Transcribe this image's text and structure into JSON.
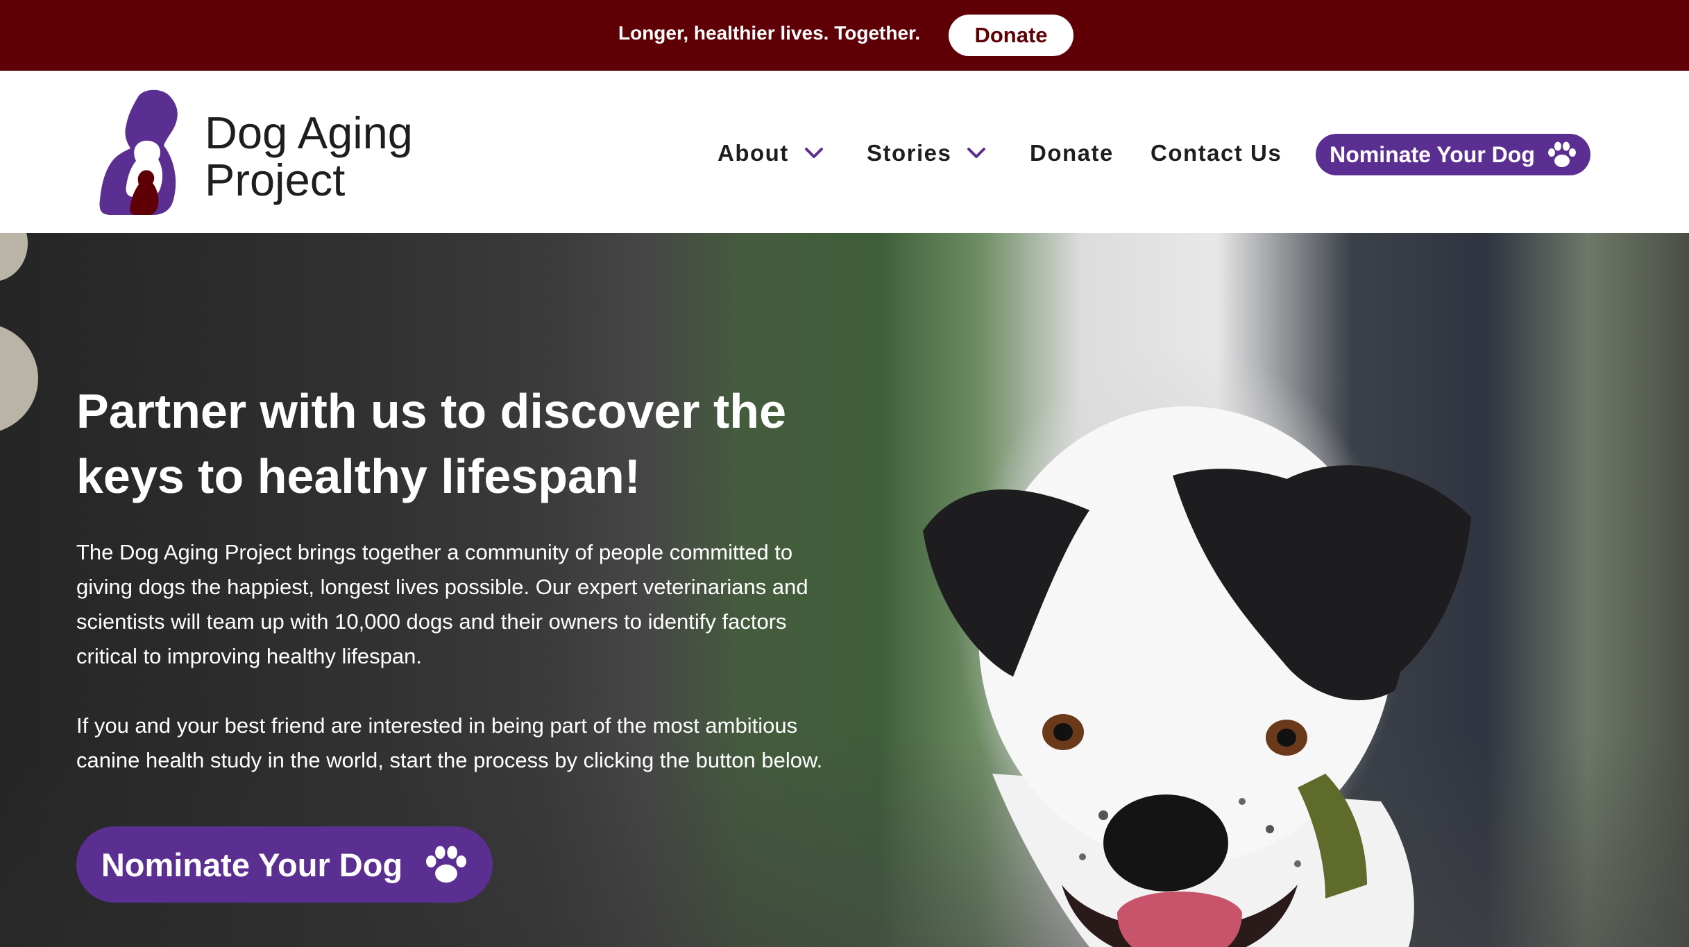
{
  "top_banner": {
    "tagline": "Longer, healthier lives. Together.",
    "donate_label": "Donate"
  },
  "header": {
    "logo_line1": "Dog Aging",
    "logo_line2": "Project",
    "nav": {
      "about": "About",
      "stories": "Stories",
      "donate": "Donate",
      "contact": "Contact Us"
    },
    "nominate_label": "Nominate Your Dog"
  },
  "hero": {
    "title": "Partner with us to discover the keys to healthy lifespan!",
    "paragraph1": "The Dog Aging Project brings together a community of people committed to giving dogs the happiest, longest lives possible. Our expert veterinarians and scientists will team up with 10,000 dogs and their owners to identify factors critical to improving healthy lifespan.",
    "paragraph2": "If you and your best friend are interested in being part of the most ambitious canine health study in the world, start the process by clicking the button below.",
    "cta_label": "Nominate Your Dog"
  },
  "colors": {
    "banner_bg": "#5e0006",
    "brand_purple": "#5b2e92"
  },
  "icons": [
    "chevron-down-icon",
    "paw-icon",
    "logo-dogs-mark"
  ]
}
